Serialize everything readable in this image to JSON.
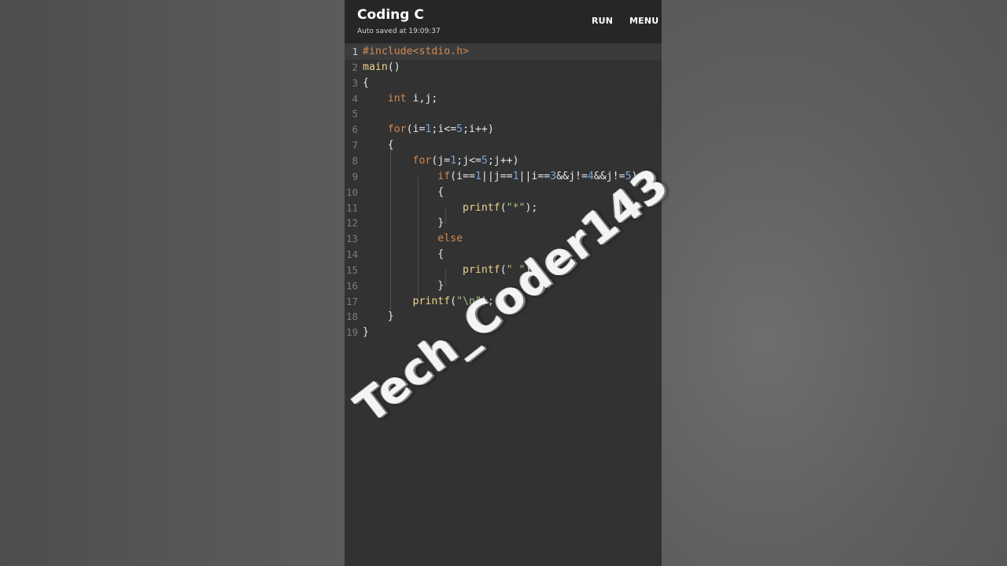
{
  "app": {
    "title": "Coding C",
    "autosave": "Auto saved at 19:09:37",
    "run_label": "RUN",
    "menu_label": "MENU"
  },
  "editor": {
    "active_line": 1,
    "lines": [
      {
        "n": "1",
        "html": "<span class='pp'>#include&lt;stdio.h&gt;</span>"
      },
      {
        "n": "2",
        "html": "<span class='fn'>main</span>()"
      },
      {
        "n": "3",
        "html": "{"
      },
      {
        "n": "4",
        "html": "    <span class='kw'>int</span> i,j;"
      },
      {
        "n": "5",
        "html": ""
      },
      {
        "n": "6",
        "html": "    <span class='kw'>for</span>(i=<span class='num'>1</span>;i&lt;=<span class='num'>5</span>;i++)"
      },
      {
        "n": "7",
        "html": "    {"
      },
      {
        "n": "8",
        "html": "        <span class='kw'>for</span>(j=<span class='num'>1</span>;j&lt;=<span class='num'>5</span>;j++)"
      },
      {
        "n": "9",
        "html": "            <span class='kw'>if</span>(i==<span class='num'>1</span>||j==<span class='num'>1</span>||i==<span class='num'>3</span>&amp;&amp;j!=<span class='num'>4</span>&amp;&amp;j!=<span class='num'>5</span>)"
      },
      {
        "n": "10",
        "html": "            {"
      },
      {
        "n": "11",
        "html": "                <span class='fn'>printf</span>(<span class='str'>\"*\"</span>);"
      },
      {
        "n": "12",
        "html": "            }"
      },
      {
        "n": "13",
        "html": "            <span class='kw'>else</span>"
      },
      {
        "n": "14",
        "html": "            {"
      },
      {
        "n": "15",
        "html": "                <span class='fn'>printf</span>(<span class='str'>\" \"</span>);"
      },
      {
        "n": "16",
        "html": "            }"
      },
      {
        "n": "17",
        "html": "        <span class='fn'>printf</span>(<span class='str'>\"\\n\"</span>);"
      },
      {
        "n": "18",
        "html": "    }"
      },
      {
        "n": "19",
        "html": "}"
      }
    ]
  },
  "watermark": "Tech_Coder143",
  "colors": {
    "keyword": "#d08a55",
    "number": "#7aa6d8",
    "string": "#a3c27c",
    "function": "#f0d28c"
  }
}
